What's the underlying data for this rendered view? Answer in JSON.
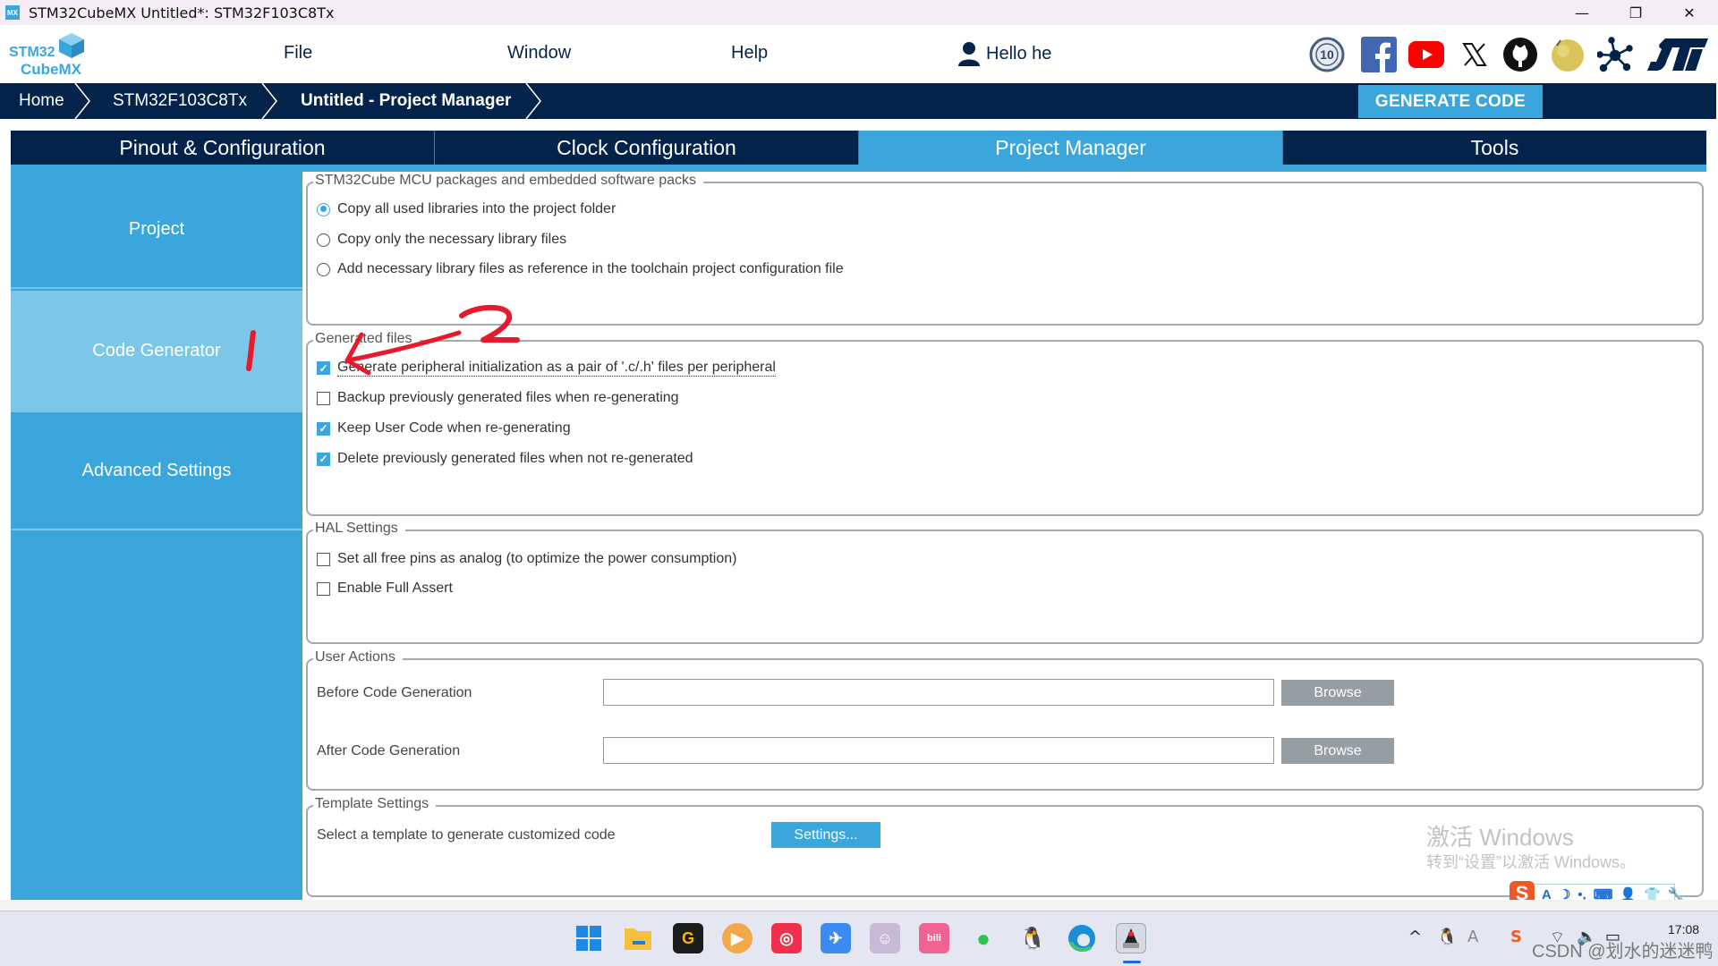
{
  "window": {
    "title": "STM32CubeMX Untitled*: STM32F103C8Tx",
    "app_icon_text": "MX",
    "controls": {
      "minimize": "—",
      "restore": "❐",
      "close": "✕"
    }
  },
  "header": {
    "logo": {
      "line1": "STM32",
      "line2": "CubeMX"
    },
    "menu": [
      "File",
      "Window",
      "Help"
    ],
    "user_greeting": "Hello he",
    "social_icons": [
      "anniversary-10-icon",
      "facebook-icon",
      "youtube-icon",
      "x-icon",
      "github-icon",
      "wikipedia-icon",
      "network-icon",
      "st-logo-icon"
    ]
  },
  "breadcrumb": {
    "items": [
      "Home",
      "STM32F103C8Tx",
      "Untitled - Project Manager"
    ],
    "generate_label": "GENERATE CODE"
  },
  "tabs": [
    {
      "label": "Pinout & Configuration",
      "active": false
    },
    {
      "label": "Clock Configuration",
      "active": false
    },
    {
      "label": "Project Manager",
      "active": true
    },
    {
      "label": "Tools",
      "active": false
    }
  ],
  "sidebar": {
    "items": [
      {
        "label": "Project",
        "active": false
      },
      {
        "label": "Code Generator",
        "active": true
      },
      {
        "label": "Advanced Settings",
        "active": false
      }
    ]
  },
  "content": {
    "packages": {
      "title": "STM32Cube MCU packages and embedded software packs",
      "options": [
        {
          "label": "Copy all used libraries into the project folder",
          "selected": true
        },
        {
          "label": "Copy only the necessary library files",
          "selected": false
        },
        {
          "label": "Add necessary library files as reference in the toolchain project configuration file",
          "selected": false
        }
      ]
    },
    "generated_files": {
      "title": "Generated files",
      "options": [
        {
          "label": "Generate peripheral initialization as a pair of '.c/.h' files per peripheral",
          "checked": true
        },
        {
          "label": "Backup previously generated files when re-generating",
          "checked": false
        },
        {
          "label": "Keep User Code when re-generating",
          "checked": true
        },
        {
          "label": "Delete previously generated files when not re-generated",
          "checked": true
        }
      ]
    },
    "hal_settings": {
      "title": "HAL Settings",
      "options": [
        {
          "label": "Set all free pins as analog (to optimize the power consumption)",
          "checked": false
        },
        {
          "label": "Enable Full Assert",
          "checked": false
        }
      ]
    },
    "user_actions": {
      "title": "User Actions",
      "rows": [
        {
          "label": "Before Code Generation",
          "value": "",
          "button": "Browse"
        },
        {
          "label": "After Code Generation",
          "value": "",
          "button": "Browse"
        }
      ]
    },
    "template_settings": {
      "title": "Template Settings",
      "label": "Select a template to generate customized code",
      "button": "Settings..."
    }
  },
  "watermark": {
    "line1": "激活 Windows",
    "line2": "转到“设置”以激活 Windows。"
  },
  "ime_bar": {
    "logo": "S",
    "items": [
      "A",
      "☽",
      "•,",
      "⌨",
      "👤",
      "👕",
      "🔧"
    ]
  },
  "taskbar": {
    "apps": [
      "windows-start",
      "file-explorer",
      "app-g",
      "video-app",
      "netease-music",
      "feishu",
      "anime-avatar",
      "bilibili",
      "wechat",
      "qq",
      "edge",
      "java-app"
    ],
    "tray": {
      "chevron": "^",
      "ime": "A",
      "time": "17:08"
    },
    "overlay_watermark": "CSDN @划水的迷迷鸭"
  },
  "annotations": {
    "marker_1": "1",
    "marker_2": "2",
    "color": "#e8192c"
  }
}
